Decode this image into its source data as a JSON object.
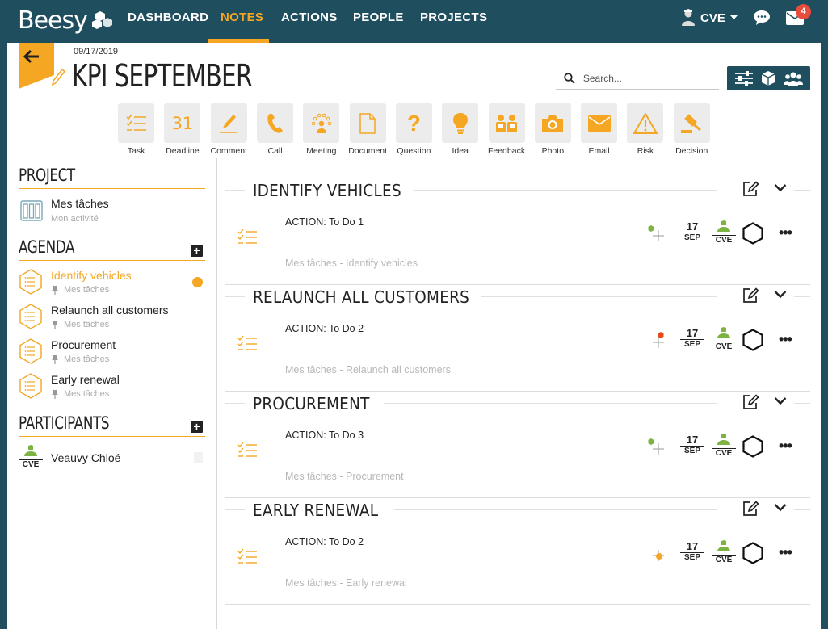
{
  "nav": {
    "logo": "Beesy",
    "items": [
      "DASHBOARD",
      "NOTES",
      "ACTIONS",
      "PEOPLE",
      "PROJECTS"
    ],
    "active": "NOTES",
    "user": "CVE",
    "message_badge": "4",
    "accent_color": "#f5a623",
    "bar_color": "#1f4e5f"
  },
  "header": {
    "date": "09/17/2019",
    "title": "KPI SEPTEMBER",
    "search_placeholder": "Search..."
  },
  "note_types": [
    {
      "label": "Task",
      "icon": "task-icon"
    },
    {
      "label": "Deadline",
      "icon": "calendar-icon",
      "glyph": "31"
    },
    {
      "label": "Comment",
      "icon": "pencil-icon"
    },
    {
      "label": "Call",
      "icon": "phone-icon"
    },
    {
      "label": "Meeting",
      "icon": "meeting-icon"
    },
    {
      "label": "Document",
      "icon": "document-icon"
    },
    {
      "label": "Question",
      "icon": "question-icon",
      "glyph": "?"
    },
    {
      "label": "Idea",
      "icon": "lightbulb-icon"
    },
    {
      "label": "Feedback",
      "icon": "feedback-icon"
    },
    {
      "label": "Photo",
      "icon": "camera-icon"
    },
    {
      "label": "Email",
      "icon": "envelope-icon"
    },
    {
      "label": "Risk",
      "icon": "warning-icon"
    },
    {
      "label": "Decision",
      "icon": "gavel-icon"
    }
  ],
  "sidebar": {
    "project_heading": "PROJECT",
    "project": {
      "name": "Mes tâches",
      "sub": "Mon activité"
    },
    "agenda_heading": "AGENDA",
    "agenda": [
      {
        "title": "Identify vehicles",
        "sub": "Mes tâches",
        "active": true
      },
      {
        "title": "Relaunch all customers",
        "sub": "Mes tâches",
        "active": false
      },
      {
        "title": "Procurement",
        "sub": "Mes tâches",
        "active": false
      },
      {
        "title": "Early renewal",
        "sub": "Mes tâches",
        "active": false
      }
    ],
    "participants_heading": "PARTICIPANTS",
    "participants": [
      {
        "initials": "CVE",
        "name": "Veauvy Chloé"
      }
    ]
  },
  "sections": [
    {
      "title": "IDENTIFY VEHICLES",
      "action": "ACTION: To Do 1",
      "path": "Mes tâches - Identify vehicles",
      "day": "17",
      "month": "SEP",
      "owner": "CVE",
      "priority": "low",
      "priority_color": "#7cb342"
    },
    {
      "title": "RELAUNCH ALL CUSTOMERS",
      "action": "ACTION: To Do 2",
      "path": "Mes tâches - Relaunch all customers",
      "day": "17",
      "month": "SEP",
      "owner": "CVE",
      "priority": "high",
      "priority_color": "#e64a19"
    },
    {
      "title": "PROCUREMENT",
      "action": "ACTION: To Do 3",
      "path": "Mes tâches - Procurement",
      "day": "17",
      "month": "SEP",
      "owner": "CVE",
      "priority": "low",
      "priority_color": "#7cb342"
    },
    {
      "title": "EARLY RENEWAL",
      "action": "ACTION: To Do 2",
      "path": "Mes tâches - Early renewal",
      "day": "17",
      "month": "SEP",
      "owner": "CVE",
      "priority": "medium",
      "priority_color": "#f5a623"
    }
  ]
}
